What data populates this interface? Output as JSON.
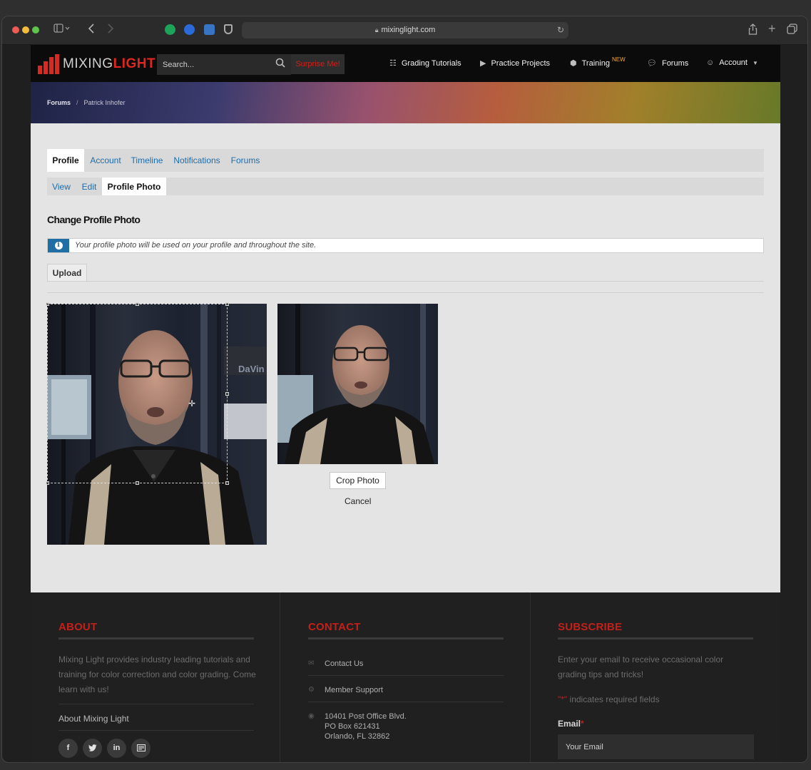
{
  "browser": {
    "url": "mixinglight.com"
  },
  "nav": {
    "logo_plain": "MIXING",
    "logo_accent": "LIGHT",
    "search_placeholder": "Search...",
    "surprise": "Surprise Me!",
    "items": [
      {
        "label": "Grading Tutorials",
        "icon": "grid-icon"
      },
      {
        "label": "Practice Projects",
        "icon": "video-icon"
      },
      {
        "label": "Training",
        "icon": "cube-icon",
        "badge": "NEW"
      },
      {
        "label": "Forums",
        "icon": "chat-icon"
      },
      {
        "label": "Account",
        "icon": "user-icon"
      }
    ]
  },
  "breadcrumb": {
    "root": "Forums",
    "current": "Patrick Inhofer"
  },
  "tabs_primary": [
    "Profile",
    "Account",
    "Timeline",
    "Notifications",
    "Forums"
  ],
  "tabs_secondary": [
    "View",
    "Edit",
    "Profile Photo"
  ],
  "page": {
    "heading": "Change Profile Photo",
    "info": "Your profile photo will be used on your profile and throughout the site.",
    "upload_tab": "Upload",
    "crop_button": "Crop Photo",
    "cancel": "Cancel"
  },
  "footer": {
    "about": {
      "heading": "ABOUT",
      "text": "Mixing Light provides industry leading tutorials and training for color correction and color grading. Come learn with us!",
      "link": "About Mixing Light"
    },
    "contact": {
      "heading": "CONTACT",
      "contact_us": "Contact Us",
      "member_support": "Member Support",
      "address_line1": "10401 Post Office Blvd.",
      "address_line2": "PO Box 621431",
      "address_line3": "Orlando, FL 32862"
    },
    "subscribe": {
      "heading": "SUBSCRIBE",
      "text": "Enter your email to receive occasional color grading tips and tricks!",
      "required_asterisk": "\"*\"",
      "required_note": " indicates required fields",
      "email_label": "Email",
      "email_placeholder": "Your Email"
    },
    "social": [
      "f",
      "t",
      "in",
      "rss"
    ]
  },
  "colors": {
    "accent_red": "#c2201b",
    "link_blue": "#1a6db0",
    "info_blue": "#1f6ea6"
  }
}
